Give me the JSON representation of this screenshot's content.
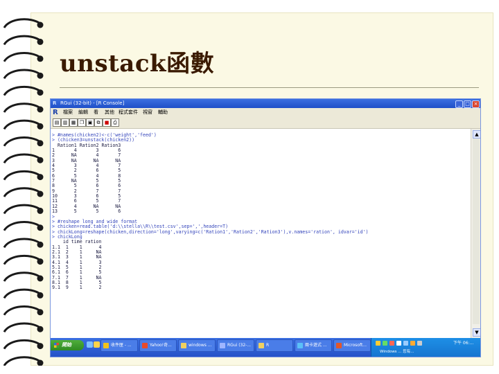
{
  "slide": {
    "title": "unstack函數"
  },
  "window": {
    "title": "RGui (32-bit) - [R Console]",
    "controls": [
      "_",
      "□",
      "×"
    ]
  },
  "menubar": {
    "items": [
      "檔案",
      "編輯",
      "看",
      "其他",
      "程式套件",
      "視窗",
      "輔助"
    ]
  },
  "toolbar": {
    "buttons": [
      "open-icon",
      "load-icon",
      "save-icon",
      "copy-icon",
      "paste-icon",
      "copy-paste-icon",
      "stop-icon",
      "print-icon"
    ]
  },
  "console": {
    "lines": [
      {
        "kind": "cmd",
        "text": "> #names(chicken2)<-c('weight','feed')"
      },
      {
        "kind": "cmd",
        "text": "> (chicken3=unstack(chicken2))"
      },
      {
        "kind": "out",
        "text": "  Ration1 Ration2 Ration3"
      },
      {
        "kind": "out",
        "text": "1       4       3       6"
      },
      {
        "kind": "out",
        "text": "2      NA       4       7"
      },
      {
        "kind": "out",
        "text": "3      NA      NA      NA"
      },
      {
        "kind": "out",
        "text": "4       3       4       7"
      },
      {
        "kind": "out",
        "text": "5       2       6       5"
      },
      {
        "kind": "out",
        "text": "6       5       4       8"
      },
      {
        "kind": "out",
        "text": "7      NA       5       5"
      },
      {
        "kind": "out",
        "text": "8       5       6       6"
      },
      {
        "kind": "out",
        "text": "9       2       7       7"
      },
      {
        "kind": "out",
        "text": "10      3       6       5"
      },
      {
        "kind": "out",
        "text": "11      6       5       7"
      },
      {
        "kind": "out",
        "text": "12      4      NA      NA"
      },
      {
        "kind": "out",
        "text": "13      5       5       6"
      },
      {
        "kind": "cmd",
        "text": ">"
      },
      {
        "kind": "cmd",
        "text": "> #reshape long and wide format"
      },
      {
        "kind": "cmd",
        "text": "> chicken=read.table('d:\\\\stella\\\\R\\\\test.csv',sep=',',header=T)"
      },
      {
        "kind": "cmd",
        "text": "> chickLong=reshape(chicken,direction='long',varying=c('Ration1','Ration2','Ration3'),v.names='ration', idvar='id')"
      },
      {
        "kind": "cmd",
        "text": "> chickLong"
      },
      {
        "kind": "out",
        "text": "    id time ration"
      },
      {
        "kind": "out",
        "text": "1.1  1    1      4"
      },
      {
        "kind": "out",
        "text": "2.1  2    1     NA"
      },
      {
        "kind": "out",
        "text": "3.1  3    1     NA"
      },
      {
        "kind": "out",
        "text": "4.1  4    1      3"
      },
      {
        "kind": "out",
        "text": "5.1  5    1      2"
      },
      {
        "kind": "out",
        "text": "6.1  6    1      5"
      },
      {
        "kind": "out",
        "text": "7.1  7    1     NA"
      },
      {
        "kind": "out",
        "text": "8.1  8    1      5"
      },
      {
        "kind": "out",
        "text": "9.1  9    1      2"
      }
    ]
  },
  "taskbar": {
    "start_label": "開始",
    "tasks": [
      {
        "label": "收件匣 - ...",
        "icon": "mail-icon",
        "color": "#f2c21b"
      },
      {
        "label": "Yahoo!奇...",
        "icon": "browser-icon",
        "color": "#e84a2a"
      },
      {
        "label": "windows ...",
        "icon": "folder-icon",
        "color": "#f0d060"
      },
      {
        "label": "RGui (32-...",
        "icon": "r-icon",
        "color": "#9fb6ff"
      },
      {
        "label": "R",
        "icon": "folder-icon",
        "color": "#f0d060"
      },
      {
        "label": "兩卡遊式 ...",
        "icon": "app-icon",
        "color": "#5bc0f8"
      },
      {
        "label": "Microsoft...",
        "icon": "powerpoint-icon",
        "color": "#e2572a"
      }
    ],
    "tray": {
      "clock": "下午 06:...",
      "sub_text": "Windows ... 您有..."
    }
  }
}
